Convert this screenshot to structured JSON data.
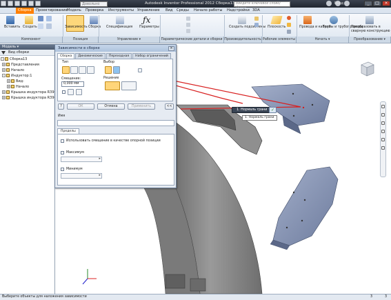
{
  "titlebar": {
    "app_title": "Autodesk Inventor Professional 2012   Сборка13",
    "dropdown_value": "Довольно",
    "search_placeholder": "Введите ключевое слово/фразу",
    "login_label": "Вход"
  },
  "menu": {
    "tabs": [
      "Сборка",
      "Проектирование",
      "Модель",
      "Проверка",
      "Инструменты",
      "Управление",
      "Вид",
      "Среды",
      "Начало работы",
      "Надстройки",
      "3DA"
    ]
  },
  "ribbon": {
    "buttons": {
      "insert": "Вставить",
      "create": "Создать",
      "constraint": "Зависимость",
      "assemble": "Сборка",
      "spec": "Спецификация",
      "params": "Параметры",
      "create_subassembly": "Создать подсистемы",
      "plane": "Плоскость",
      "cables": "Провода и кабели",
      "tubes": "Трубы и трубопроводы",
      "convert": "Преобразовать в сварную конструкцию"
    },
    "groups": [
      "Компонент",
      "Позиция",
      "Управление ▾",
      "Параметрические детали и сборки",
      "Производительность",
      "Рабочие элементы",
      "Начать ▾",
      "Преобразование ▾"
    ]
  },
  "browser": {
    "title": "Модель ▾",
    "view_label": "Вид сборки",
    "items": [
      {
        "label": "Сборка13",
        "expand": "-"
      },
      {
        "label": "Представления",
        "expand": "+"
      },
      {
        "label": "Начало",
        "expand": "+"
      },
      {
        "label": "Индуктор:1",
        "expand": "-"
      },
      {
        "label": "Вид:",
        "expand": "+"
      },
      {
        "label": "Начало",
        "expand": "+"
      },
      {
        "label": "Крышка индуктора R396",
        "expand": "+"
      },
      {
        "label": "Крышка индуктора R396",
        "expand": "+"
      }
    ]
  },
  "dialog": {
    "title": "Зависимости в сборке",
    "tabs": [
      "Сборка",
      "Динамические",
      "Переходная",
      "Набор ограничений"
    ],
    "type_label": "Тип",
    "selection_label": "Выбор",
    "offset_label": "Смещение:",
    "offset_value": "0,000 мм",
    "solution_label": "Решение",
    "ok_label": "ОК",
    "cancel_label": "Отмена",
    "apply_label": "Применить",
    "more_label": "<<",
    "name_label": "Имя",
    "limits_tab": "Пределы",
    "use_offset_label": "Использовать смещение в качестве опорной позиции",
    "max_label": "Максимум",
    "min_label": "Минимум"
  },
  "viewport": {
    "pick_chip": "1. Нормаль грани",
    "pick_tip": "1. Нормаль грани",
    "ok_icon": "check-icon"
  },
  "status": {
    "text": "Выберите объекты для наложения зависимости",
    "n1": "3",
    "n2": "3"
  },
  "colors": {
    "accent_tab": "#ff7f00",
    "arrow_red": "#d82020",
    "part_blue": "#8996b5",
    "ring_gray": "#8a8a8a"
  }
}
